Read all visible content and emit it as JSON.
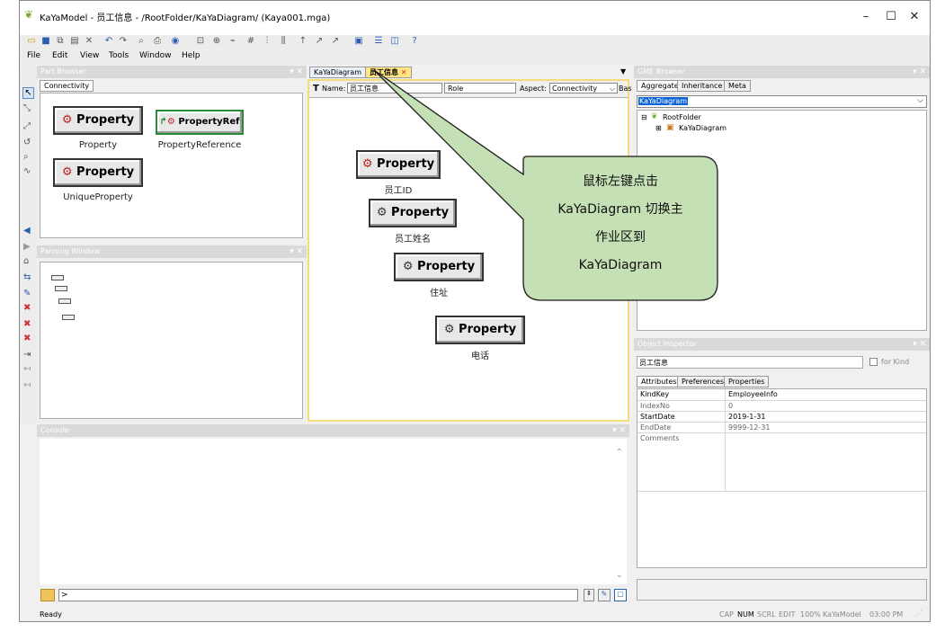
{
  "window": {
    "title": "KaYaModel - 员工信息 - /RootFolder/KaYaDiagram/ (Kaya001.mga)",
    "minimize": "–",
    "maximize": "☐",
    "close": "✕"
  },
  "menu": [
    "File",
    "Edit",
    "View",
    "Tools",
    "Window",
    "Help"
  ],
  "part_browser": {
    "title": "Part Browser",
    "tab": "Connectivity",
    "parts": [
      {
        "box": "Property",
        "label": "Property"
      },
      {
        "box": "PropertyRef",
        "label": "PropertyReference"
      },
      {
        "box": "Property",
        "label": "UniqueProperty"
      }
    ]
  },
  "panning": {
    "title": "Panning Window"
  },
  "editor": {
    "tabs": [
      "KaYaDiagram",
      "员工信息"
    ],
    "name_label": "Name:",
    "name_value": "员工信息",
    "role": "Role",
    "aspect_label": "Aspect:",
    "aspect_value": "Connectivity",
    "base": "Bas",
    "props": [
      {
        "box": "Property",
        "label": "员工ID"
      },
      {
        "box": "Property",
        "label": "员工姓名"
      },
      {
        "box": "Property",
        "label": "住址"
      },
      {
        "box": "Property",
        "label": "电话"
      }
    ],
    "callout": [
      "鼠标左键点击",
      "KaYaDiagram 切换主",
      "作业区到",
      "KaYaDiagram"
    ]
  },
  "console": {
    "title": "Console",
    "input": ">"
  },
  "gme_browser": {
    "title": "GME Browser",
    "tabs": [
      "Aggregate",
      "Inheritance",
      "Meta"
    ],
    "selected": "KaYaDiagram",
    "tree": [
      "RootFolder",
      "KaYaDiagram"
    ]
  },
  "inspector": {
    "title": "Object Inspector",
    "object": "员工信息",
    "for_kind": "for Kind",
    "tabs": [
      "Attributes",
      "Preferences",
      "Properties"
    ],
    "rows": [
      {
        "k": "KindKey",
        "v": "EmployeeInfo"
      },
      {
        "k": "IndexNo",
        "v": "0"
      },
      {
        "k": "StartDate",
        "v": "2019-1-31"
      },
      {
        "k": "EndDate",
        "v": "9999-12-31"
      },
      {
        "k": "Comments",
        "v": ""
      }
    ]
  },
  "status": {
    "ready": "Ready",
    "indicators": [
      "CAP",
      "NUM",
      "SCRL",
      "EDIT",
      "100%",
      "KaYaModel",
      "03:00 PM"
    ]
  }
}
